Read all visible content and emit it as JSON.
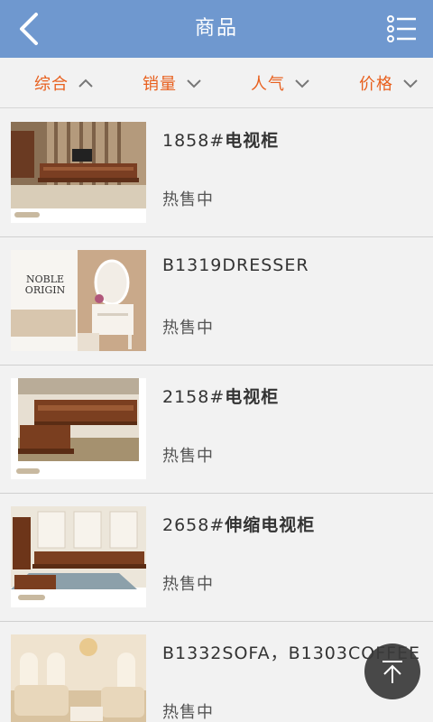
{
  "header": {
    "title": "商品",
    "back_icon": "chevron-left-icon",
    "menu_icon": "list-menu-icon"
  },
  "colors": {
    "header_bg": "#6f98cf",
    "sort_accent": "#e8601e"
  },
  "sort": [
    {
      "label": "综合",
      "icon": "chevron-up-icon"
    },
    {
      "label": "销量",
      "icon": "chevron-down-icon"
    },
    {
      "label": "人气",
      "icon": "chevron-down-icon"
    },
    {
      "label": "价格",
      "icon": "chevron-down-icon"
    }
  ],
  "products": [
    {
      "code": "1858#",
      "name": "电视柜",
      "status": "热售中"
    },
    {
      "code": "B1319DRESSER",
      "name": "",
      "status": "热售中"
    },
    {
      "code": "2158#",
      "name": "电视柜",
      "status": "热售中"
    },
    {
      "code": "2658#",
      "name": "伸缩电视柜",
      "status": "热售中"
    },
    {
      "code": "B1332SOFA，B1303COFFEE",
      "name": "",
      "status": "热售中"
    }
  ],
  "thumb_text": {
    "brand_line1": "NOBLE",
    "brand_line2": "ORIGIN"
  },
  "scroll_top_icon": "arrow-up-icon"
}
